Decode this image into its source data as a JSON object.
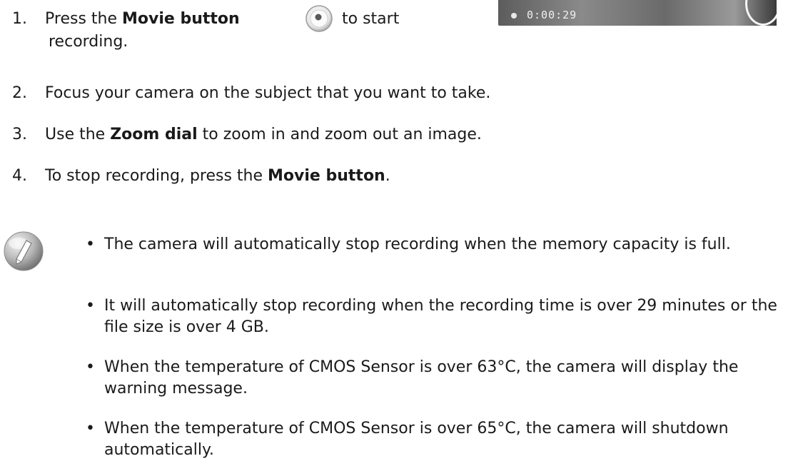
{
  "camera_preview": {
    "time": "0:00:29"
  },
  "steps": [
    {
      "number": "1.",
      "line1_pre": "Press the ",
      "line1_bold": "Movie button",
      "line1_post": "to start",
      "line2": "recording."
    },
    {
      "number": "2.",
      "text": "Focus your camera on the subject that you want to take."
    },
    {
      "number": "3.",
      "pre": "Use the ",
      "bold": "Zoom dial",
      "post": " to zoom in and zoom out an image."
    },
    {
      "number": "4.",
      "pre": "To stop recording, press the ",
      "bold": "Movie button",
      "post": "."
    }
  ],
  "notes": [
    "The camera will automatically stop recording when the memory capacity is full.",
    "It will automatically stop recording when the recording time is over 29 minutes or the file size is over 4 GB.",
    "When the temperature of CMOS Sensor is over 63°C, the camera will display the warning message.",
    "When the temperature of CMOS Sensor is over 65°C, the camera will shutdown automatically."
  ],
  "bullet_char": "•"
}
